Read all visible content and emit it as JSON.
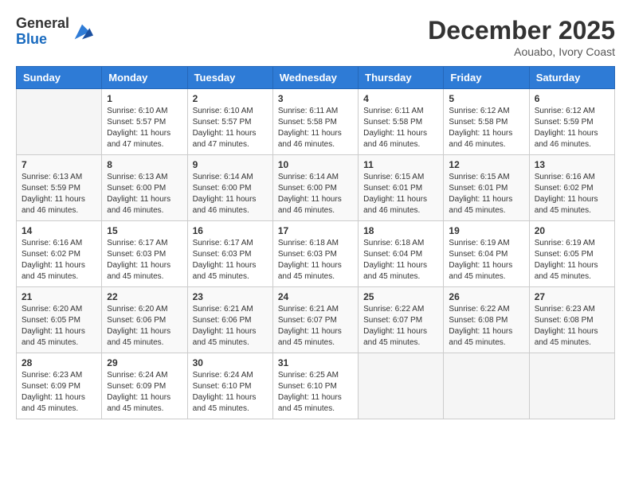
{
  "logo": {
    "general": "General",
    "blue": "Blue"
  },
  "title": "December 2025",
  "subtitle": "Aouabo, Ivory Coast",
  "days_of_week": [
    "Sunday",
    "Monday",
    "Tuesday",
    "Wednesday",
    "Thursday",
    "Friday",
    "Saturday"
  ],
  "weeks": [
    [
      {
        "day": "",
        "info": ""
      },
      {
        "day": "1",
        "info": "Sunrise: 6:10 AM\nSunset: 5:57 PM\nDaylight: 11 hours and 47 minutes."
      },
      {
        "day": "2",
        "info": "Sunrise: 6:10 AM\nSunset: 5:57 PM\nDaylight: 11 hours and 47 minutes."
      },
      {
        "day": "3",
        "info": "Sunrise: 6:11 AM\nSunset: 5:58 PM\nDaylight: 11 hours and 46 minutes."
      },
      {
        "day": "4",
        "info": "Sunrise: 6:11 AM\nSunset: 5:58 PM\nDaylight: 11 hours and 46 minutes."
      },
      {
        "day": "5",
        "info": "Sunrise: 6:12 AM\nSunset: 5:58 PM\nDaylight: 11 hours and 46 minutes."
      },
      {
        "day": "6",
        "info": "Sunrise: 6:12 AM\nSunset: 5:59 PM\nDaylight: 11 hours and 46 minutes."
      }
    ],
    [
      {
        "day": "7",
        "info": "Sunrise: 6:13 AM\nSunset: 5:59 PM\nDaylight: 11 hours and 46 minutes."
      },
      {
        "day": "8",
        "info": "Sunrise: 6:13 AM\nSunset: 6:00 PM\nDaylight: 11 hours and 46 minutes."
      },
      {
        "day": "9",
        "info": "Sunrise: 6:14 AM\nSunset: 6:00 PM\nDaylight: 11 hours and 46 minutes."
      },
      {
        "day": "10",
        "info": "Sunrise: 6:14 AM\nSunset: 6:00 PM\nDaylight: 11 hours and 46 minutes."
      },
      {
        "day": "11",
        "info": "Sunrise: 6:15 AM\nSunset: 6:01 PM\nDaylight: 11 hours and 46 minutes."
      },
      {
        "day": "12",
        "info": "Sunrise: 6:15 AM\nSunset: 6:01 PM\nDaylight: 11 hours and 45 minutes."
      },
      {
        "day": "13",
        "info": "Sunrise: 6:16 AM\nSunset: 6:02 PM\nDaylight: 11 hours and 45 minutes."
      }
    ],
    [
      {
        "day": "14",
        "info": "Sunrise: 6:16 AM\nSunset: 6:02 PM\nDaylight: 11 hours and 45 minutes."
      },
      {
        "day": "15",
        "info": "Sunrise: 6:17 AM\nSunset: 6:03 PM\nDaylight: 11 hours and 45 minutes."
      },
      {
        "day": "16",
        "info": "Sunrise: 6:17 AM\nSunset: 6:03 PM\nDaylight: 11 hours and 45 minutes."
      },
      {
        "day": "17",
        "info": "Sunrise: 6:18 AM\nSunset: 6:03 PM\nDaylight: 11 hours and 45 minutes."
      },
      {
        "day": "18",
        "info": "Sunrise: 6:18 AM\nSunset: 6:04 PM\nDaylight: 11 hours and 45 minutes."
      },
      {
        "day": "19",
        "info": "Sunrise: 6:19 AM\nSunset: 6:04 PM\nDaylight: 11 hours and 45 minutes."
      },
      {
        "day": "20",
        "info": "Sunrise: 6:19 AM\nSunset: 6:05 PM\nDaylight: 11 hours and 45 minutes."
      }
    ],
    [
      {
        "day": "21",
        "info": "Sunrise: 6:20 AM\nSunset: 6:05 PM\nDaylight: 11 hours and 45 minutes."
      },
      {
        "day": "22",
        "info": "Sunrise: 6:20 AM\nSunset: 6:06 PM\nDaylight: 11 hours and 45 minutes."
      },
      {
        "day": "23",
        "info": "Sunrise: 6:21 AM\nSunset: 6:06 PM\nDaylight: 11 hours and 45 minutes."
      },
      {
        "day": "24",
        "info": "Sunrise: 6:21 AM\nSunset: 6:07 PM\nDaylight: 11 hours and 45 minutes."
      },
      {
        "day": "25",
        "info": "Sunrise: 6:22 AM\nSunset: 6:07 PM\nDaylight: 11 hours and 45 minutes."
      },
      {
        "day": "26",
        "info": "Sunrise: 6:22 AM\nSunset: 6:08 PM\nDaylight: 11 hours and 45 minutes."
      },
      {
        "day": "27",
        "info": "Sunrise: 6:23 AM\nSunset: 6:08 PM\nDaylight: 11 hours and 45 minutes."
      }
    ],
    [
      {
        "day": "28",
        "info": "Sunrise: 6:23 AM\nSunset: 6:09 PM\nDaylight: 11 hours and 45 minutes."
      },
      {
        "day": "29",
        "info": "Sunrise: 6:24 AM\nSunset: 6:09 PM\nDaylight: 11 hours and 45 minutes."
      },
      {
        "day": "30",
        "info": "Sunrise: 6:24 AM\nSunset: 6:10 PM\nDaylight: 11 hours and 45 minutes."
      },
      {
        "day": "31",
        "info": "Sunrise: 6:25 AM\nSunset: 6:10 PM\nDaylight: 11 hours and 45 minutes."
      },
      {
        "day": "",
        "info": ""
      },
      {
        "day": "",
        "info": ""
      },
      {
        "day": "",
        "info": ""
      }
    ]
  ]
}
